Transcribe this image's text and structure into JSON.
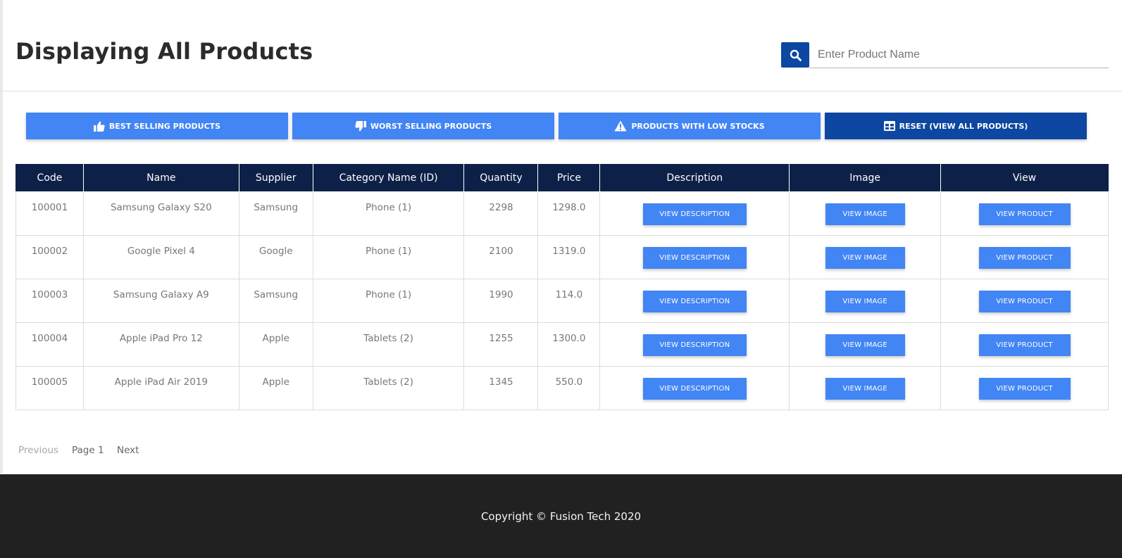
{
  "header": {
    "title": "Displaying All Products",
    "search": {
      "placeholder": "Enter Product Name",
      "value": "",
      "icon": "search-icon"
    }
  },
  "filters": [
    {
      "label": "BEST SELLING PRODUCTS",
      "icon": "thumbs-up-icon",
      "active": false
    },
    {
      "label": "WORST SELLING PRODUCTS",
      "icon": "thumbs-down-icon",
      "active": false
    },
    {
      "label": "PRODUCTS WITH LOW STOCKS",
      "icon": "warning-icon",
      "active": false
    },
    {
      "label": "RESET (VIEW ALL PRODUCTS)",
      "icon": "table-icon",
      "active": true
    }
  ],
  "table": {
    "columns": [
      "Code",
      "Name",
      "Supplier",
      "Category Name (ID)",
      "Quantity",
      "Price",
      "Description",
      "Image",
      "View"
    ],
    "rows": [
      {
        "code": "100001",
        "name": "Samsung Galaxy S20",
        "supplier": "Samsung",
        "category": "Phone (1)",
        "quantity": "2298",
        "price": "1298.0"
      },
      {
        "code": "100002",
        "name": "Google Pixel 4",
        "supplier": "Google",
        "category": "Phone (1)",
        "quantity": "2100",
        "price": "1319.0"
      },
      {
        "code": "100003",
        "name": "Samsung Galaxy A9",
        "supplier": "Samsung",
        "category": "Phone (1)",
        "quantity": "1990",
        "price": "114.0"
      },
      {
        "code": "100004",
        "name": "Apple iPad Pro 12",
        "supplier": "Apple",
        "category": "Tablets (2)",
        "quantity": "1255",
        "price": "1300.0"
      },
      {
        "code": "100005",
        "name": "Apple iPad Air 2019",
        "supplier": "Apple",
        "category": "Tablets (2)",
        "quantity": "1345",
        "price": "550.0"
      }
    ],
    "buttons": {
      "description": "VIEW DESCRIPTION",
      "image": "VIEW IMAGE",
      "product": "VIEW PRODUCT"
    }
  },
  "pagination": {
    "previous": "Previous",
    "page": "Page 1",
    "next": "Next"
  },
  "footer": {
    "copyright": "Copyright © Fusion Tech 2020"
  },
  "colors": {
    "primary": "#4285f4",
    "primary_dark": "#0d47a1",
    "table_header": "#0d2148",
    "footer": "#212121"
  }
}
